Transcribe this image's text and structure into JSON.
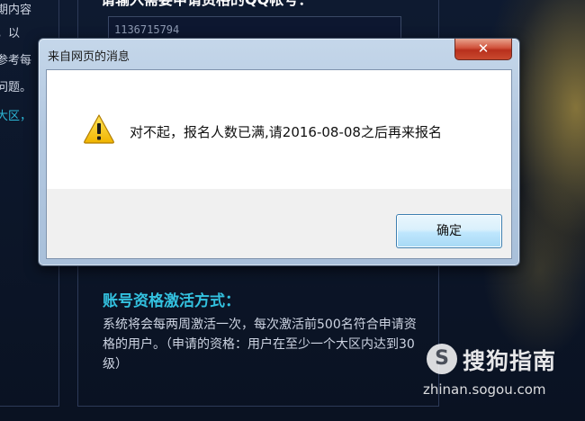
{
  "background": {
    "left_fragments": [
      "期内容",
      "，以",
      "参考每",
      "问题。",
      "大区，"
    ],
    "panel_heading": "请输入需要申请资格的QQ帐号：",
    "qq_value": "1136715794",
    "section_title": "账号资格激活方式：",
    "section_text": "系统将会每两周激活一次，每次激活前500名符合申请资格的用户。（申请的资格：用户在至少一个大区内达到30级）",
    "watermark": {
      "logo_glyph": "S",
      "title": "搜狗指南",
      "url": "zhinan.sogou.com"
    }
  },
  "dialog": {
    "title": "来自网页的消息",
    "close_glyph": "✕",
    "icon": "warning-icon",
    "message": "对不起，报名人数已满,请2016-08-08之后再来报名",
    "ok_label": "确定"
  },
  "colors": {
    "page_bg": "#0b1426",
    "accent_cyan": "#33c2e0",
    "close_red": "#c9492f",
    "button_blue": "#bee6fd",
    "warning_yellow": "#f5c400"
  }
}
